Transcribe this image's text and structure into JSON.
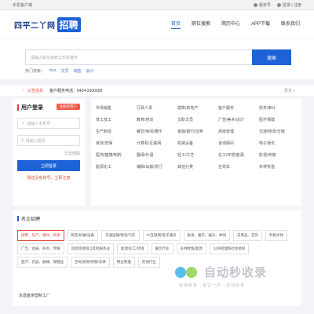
{
  "topbar": {
    "left": "手机客户端",
    "service": "服务号",
    "login_register": "登录 | 注册"
  },
  "header": {
    "logo_text": "四平二丫网",
    "logo_badge": "招聘",
    "nav": [
      "首页",
      "职位搜索",
      "简历中心",
      "APP下载",
      "联系我们"
    ]
  },
  "search": {
    "placeholder": "请输入职位或者公司关键字",
    "button": "搜索",
    "hot_label": "热门搜索：",
    "hot_keywords": [
      "four",
      "文员",
      "销售",
      "会计"
    ]
  },
  "notice": {
    "label": "公告信息",
    "text": "客户服务电话：0434-3100005",
    "more": "更多 »"
  },
  "login": {
    "title": "用户登录",
    "register_btn": "注册新用户",
    "username_placeholder": "请输入手机号",
    "password_placeholder": "请输入密码",
    "forgot": "忘记密码",
    "submit": "立即登录",
    "links": "我还没有账号，立即注册"
  },
  "categories": [
    "市场销售",
    "行政人事",
    "建筑/房地产",
    "客户服务",
    "财务/审计",
    "普工技工",
    "教育/培训",
    "文职文员",
    "广告/美术/设计",
    "医疗保健",
    "生产制造",
    "餐饮/休闲/娱乐",
    "金融/银行/证券",
    "高级管理",
    "交通/物流/仓储",
    "家政/安保",
    "计算机/互联网",
    "机械设备",
    "咨询顾问",
    "电子通讯",
    "医药/健康/制药",
    "翻译/外语",
    "轻工/工艺",
    "化工/环境/能源",
    "影视/传媒",
    "能源化工",
    "编辑/出版/发行",
    "其他分类",
    "在驾车",
    "农林牧渔"
  ],
  "famous": {
    "title": "名企招聘",
    "tags": [
      "招聘、房产、建材、装潢",
      "制造/机械/设备",
      "交通运输/物流/汽车",
      "IT/互联网/电子通讯",
      "批发、餐饮、娱乐、休闲",
      "日用品、百货",
      "科教文体",
      "广告、会展、商务、传媒",
      "其他其他和以其他服务业",
      "能源/化工/环境",
      "餐饮行业",
      "农林牧渔/能源",
      "公共管理和社会组织",
      "医疗、药品、器械、保健品",
      "咨询/贸易/财税/法律",
      "物业管理",
      "其他行业"
    ],
    "company": "永嘉盛世塑制工厂"
  },
  "watermark": {
    "text": "自动秒收录",
    "sub": "快速收录→来访一次→自动收录"
  }
}
